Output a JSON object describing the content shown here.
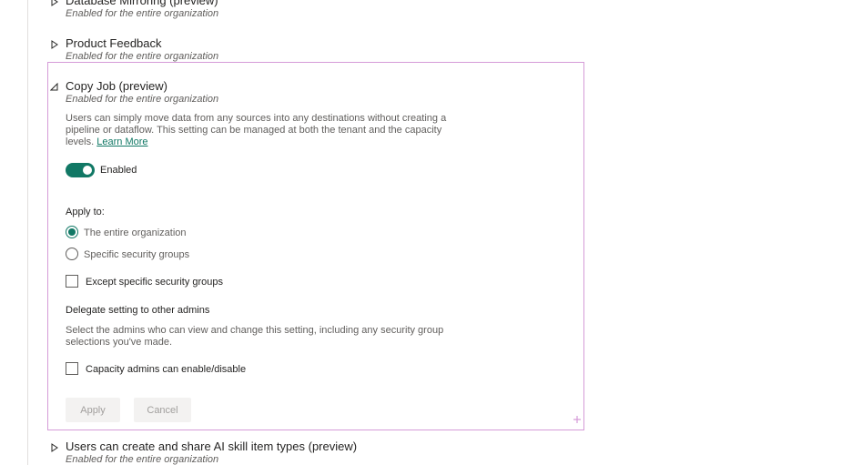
{
  "settings": [
    {
      "title": "Database Mirroring (preview)",
      "status": "Enabled for the entire organization"
    },
    {
      "title": "Product Feedback",
      "status": "Enabled for the entire organization"
    },
    {
      "title": "Copy Job (preview)",
      "status": "Enabled for the entire organization"
    },
    {
      "title": "Users can create and share AI skill item types (preview)",
      "status": "Enabled for the entire organization"
    }
  ],
  "copy_job": {
    "description": "Users can simply move data from any sources into any destinations without creating a pipeline or dataflow. This setting can be managed at both the tenant and the capacity levels.",
    "learn_more": "Learn More",
    "toggle_label": "Enabled",
    "toggle_on": true,
    "apply_to_label": "Apply to:",
    "apply_options": [
      {
        "label": "The entire organization",
        "selected": true
      },
      {
        "label": "Specific security groups",
        "selected": false
      }
    ],
    "except_label": "Except specific security groups",
    "delegate_heading": "Delegate setting to other admins",
    "delegate_description": "Select the admins who can view and change this setting, including any security group selections you've made.",
    "capacity_admins_label": "Capacity admins can enable/disable",
    "apply_button": "Apply",
    "cancel_button": "Cancel"
  },
  "colors": {
    "accent": "#117865",
    "selection_border": "#d59bd8",
    "muted_text": "#605e5c"
  }
}
